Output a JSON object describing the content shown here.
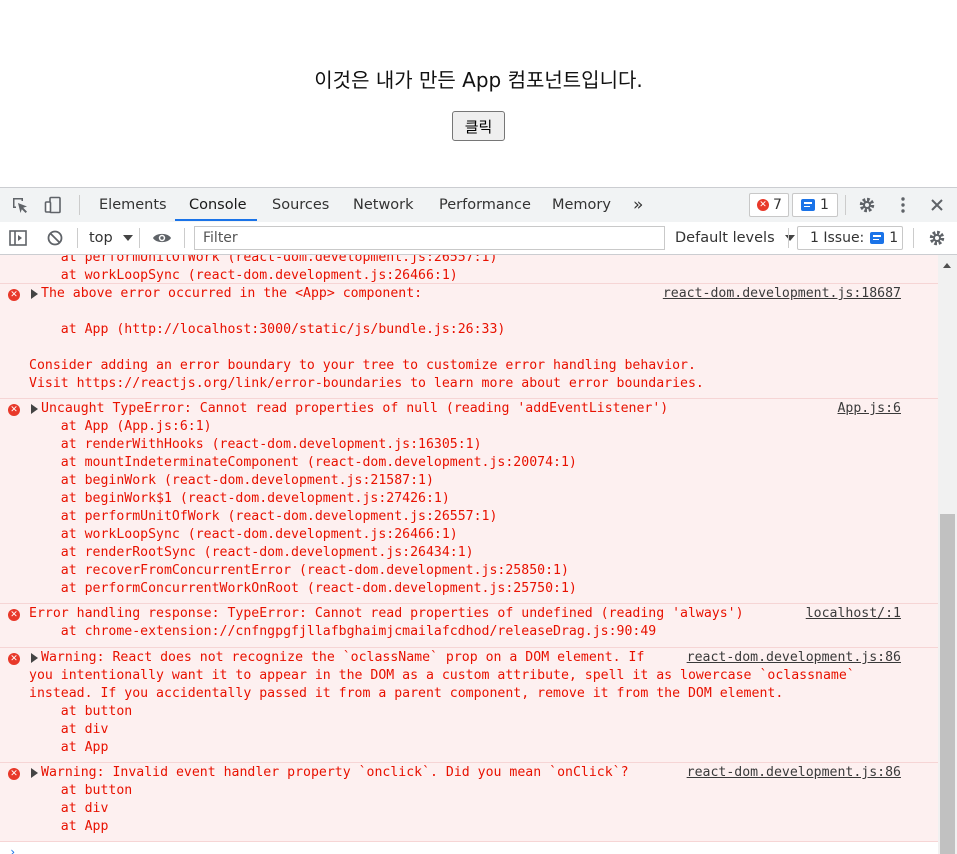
{
  "page": {
    "title": "이것은 내가 만든 App 컴포넌트입니다.",
    "button_label": "클릭"
  },
  "devtools": {
    "tabs": [
      "Elements",
      "Console",
      "Sources",
      "Network",
      "Performance",
      "Memory"
    ],
    "more_tabs_icon": "»",
    "error_count": "7",
    "message_count": "1",
    "toolbar": {
      "context": "top",
      "filter_placeholder": "Filter",
      "levels": "Default levels",
      "issues_label": "1 Issue:",
      "issues_count": "1"
    }
  },
  "console": {
    "partial_lines": [
      "    at performUnitOfWork (react-dom.development.js:26557:1)",
      "    at workLoopSync (react-dom.development.js:26466:1)"
    ],
    "messages": [
      {
        "lines": [
          "The above error occurred in the <App> component:",
          "",
          "    at App (http://localhost:3000/static/js/bundle.js:26:33)",
          "",
          "Consider adding an error boundary to your tree to customize error handling behavior.",
          "Visit https://reactjs.org/link/error-boundaries to learn more about error boundaries."
        ],
        "source": "react-dom.development.js:18687"
      },
      {
        "lines": [
          "Uncaught TypeError: Cannot read properties of null (reading 'addEventListener')",
          "    at App (App.js:6:1)",
          "    at renderWithHooks (react-dom.development.js:16305:1)",
          "    at mountIndeterminateComponent (react-dom.development.js:20074:1)",
          "    at beginWork (react-dom.development.js:21587:1)",
          "    at beginWork$1 (react-dom.development.js:27426:1)",
          "    at performUnitOfWork (react-dom.development.js:26557:1)",
          "    at workLoopSync (react-dom.development.js:26466:1)",
          "    at renderRootSync (react-dom.development.js:26434:1)",
          "    at recoverFromConcurrentError (react-dom.development.js:25850:1)",
          "    at performConcurrentWorkOnRoot (react-dom.development.js:25750:1)"
        ],
        "source": "App.js:6"
      },
      {
        "lines": [
          "Error handling response: TypeError: Cannot read properties of undefined (reading 'always')",
          "    at chrome-extension://cnfngpgfjllafbghaimjcmailafcdhod/releaseDrag.js:90:49"
        ],
        "source": "localhost/:1"
      },
      {
        "lines": [
          "Warning: React does not recognize the `oclassName` prop on a DOM element. If",
          "you intentionally want it to appear in the DOM as a custom attribute, spell it as lowercase `oclassname`",
          "instead. If you accidentally passed it from a parent component, remove it from the DOM element.",
          "    at button",
          "    at div",
          "    at App"
        ],
        "source": "react-dom.development.js:86"
      },
      {
        "lines": [
          "Warning: Invalid event handler property `onclick`. Did you mean `onClick`?",
          "    at button",
          "    at div",
          "    at App"
        ],
        "source": "react-dom.development.js:86"
      }
    ]
  }
}
